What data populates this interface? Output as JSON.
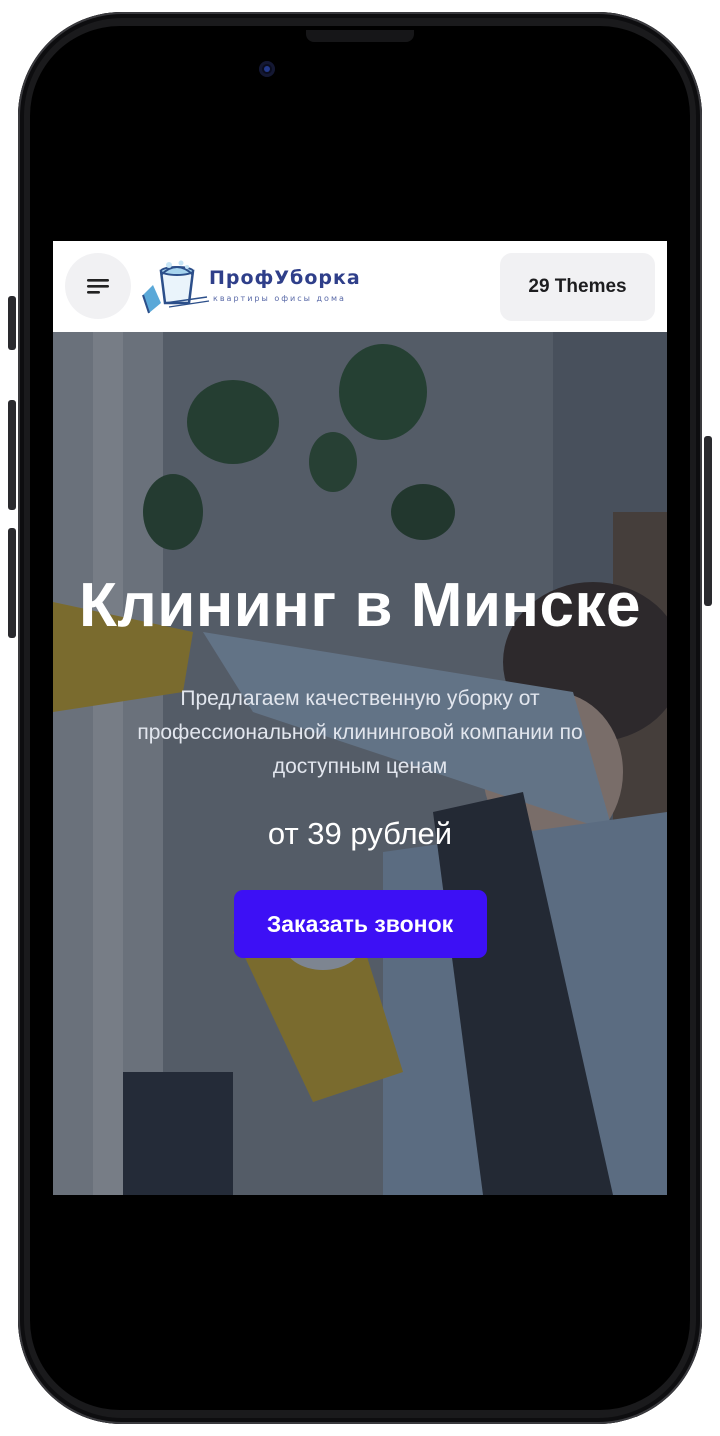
{
  "header": {
    "logo_title": "ПрофУборка",
    "logo_subtitle": "квартиры офисы дома",
    "themes_label": "29 Themes"
  },
  "hero": {
    "title": "Клининг в Минске",
    "description": "Предлагаем качественную уборку от профессиональной клининговой компании по доступным ценам",
    "price": "от 39 рублей",
    "cta_label": "Заказать звонок"
  },
  "colors": {
    "accent": "#3d10f5",
    "logo": "#2f3f8a",
    "glove": "#d9b52c"
  },
  "icons": [
    "menu-icon",
    "bucket-logo-icon"
  ]
}
